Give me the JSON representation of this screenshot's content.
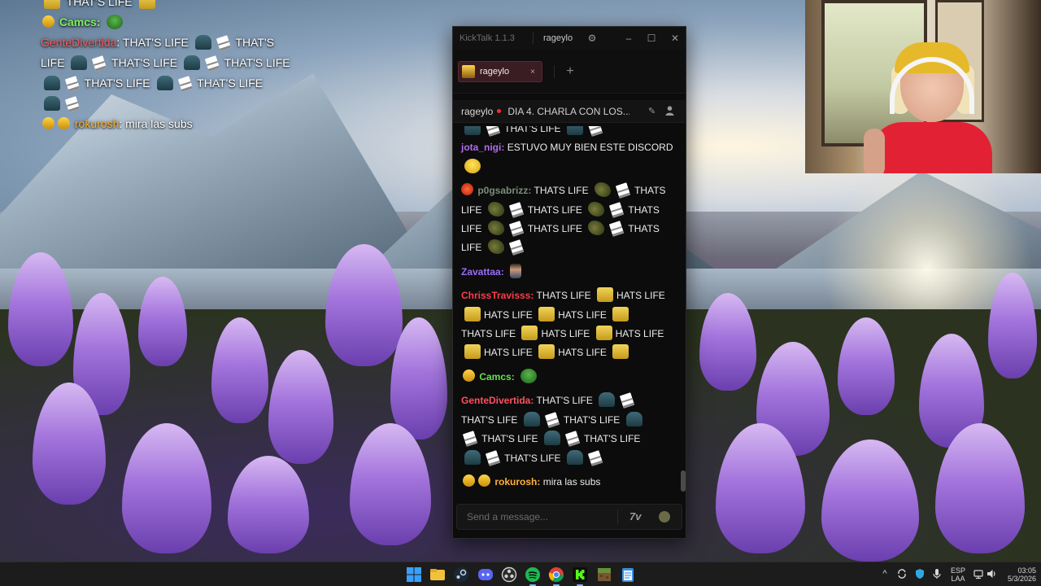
{
  "overlay_chat": {
    "top_line": "THAT'S LIFE",
    "camcs_user": "Camcs:",
    "gente_user": "GenteDivertida",
    "gente_text_1": ": THAT'S LIFE",
    "gente_text_2": "THAT'S",
    "gente_text_3": "LIFE",
    "gente_text_4": "THAT'S LIFE",
    "gente_text_5": "THAT'S LIFE",
    "gente_text_6": "THAT'S LIFE",
    "gente_text_7": "THAT'S LIFE",
    "roku_user": "rokurosh",
    "roku_text": ": mira las subs"
  },
  "kicktalk": {
    "app_title": "KickTalk 1.1.3",
    "account": "rageylo",
    "tab_label": "rageylo",
    "tab_close": "×",
    "add_tab": "+",
    "stream_user": "rageylo",
    "stream_title": "DIA 4. CHARLA CON LOS...",
    "input_placeholder": "Send a message...",
    "seventv_label": "7v",
    "messages": {
      "top_partial": "THAT'S LIFE",
      "jota_user": "jota_nigi:",
      "jota_text": "ESTUVO MUY BIEN ESTE DISCORD",
      "p0g_user": "p0gsabrizz:",
      "p0g_text_1": "THATS LIFE",
      "p0g_text_2": "THATS",
      "p0g_text_3": "LIFE",
      "p0g_text_4": "THATS LIFE",
      "p0g_text_5": "THATS",
      "p0g_text_6": "LIFE",
      "p0g_text_7": "THATS LIFE",
      "p0g_text_8": "THATS",
      "p0g_text_9": "LIFE",
      "zav_user": "Zavattaa:",
      "chriss_user": "ChrissTravisss:",
      "chriss_text_1": "THATS LIFE",
      "chriss_text_2": "HATS LIFE",
      "chriss_text_3": "HATS LIFE",
      "chriss_text_4": "HATS LIFE",
      "chriss_text_5": "THATS LIFE",
      "chriss_text_6": "HATS LIFE",
      "chriss_text_7": "HATS LIFE",
      "chriss_text_8": "HATS LIFE",
      "chriss_text_9": "HATS LIFE",
      "camcs_user": "Camcs:",
      "gente_user": "GenteDivertida:",
      "gente_text_1": "THAT'S LIFE",
      "gente_text_2": "THAT'S LIFE",
      "gente_text_3": "THAT'S LIFE",
      "gente_text_4": "THAT'S LIFE",
      "gente_text_5": "THAT'S LIFE",
      "gente_text_6": "THAT'S LIFE",
      "roku_user": "rokurosh:",
      "roku_text": "mira las subs"
    }
  },
  "taskbar": {
    "icons": [
      "windows-start-icon",
      "file-explorer-icon",
      "steam-icon",
      "discord-icon",
      "obs-icon",
      "spotify-icon",
      "chrome-icon",
      "kick-icon",
      "minecraft-icon",
      "notepad-icon"
    ],
    "lang_top": "ESP",
    "lang_bottom": "LAA",
    "time": "03:05",
    "date": "5/3/2026"
  },
  "colors": {
    "accent_live": "#ff2a2a",
    "tab_bg": "#3a1d22",
    "kick_green": "#53fc18",
    "spotify_green": "#1db954"
  }
}
